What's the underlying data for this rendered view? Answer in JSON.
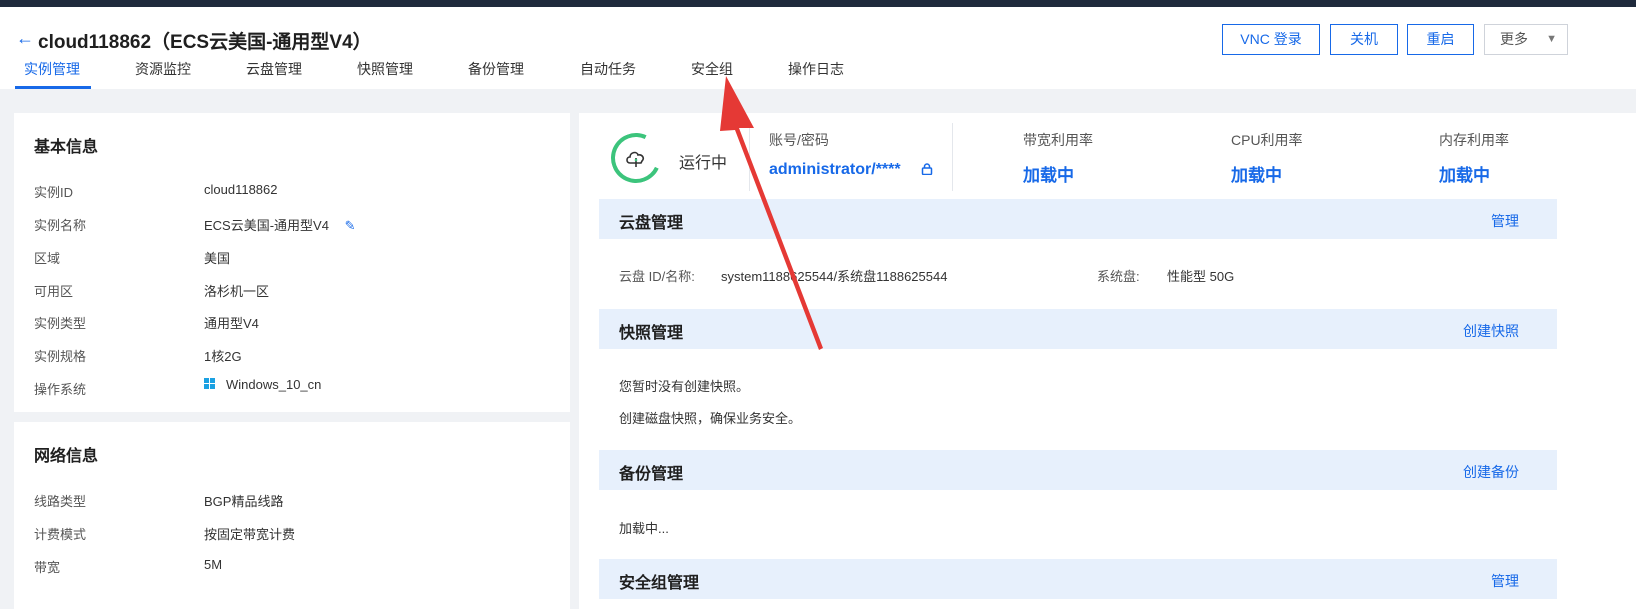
{
  "header": {
    "title": "cloud118862（ECS云美国-通用型V4）",
    "buttons": {
      "vnc": "VNC 登录",
      "shutdown": "关机",
      "restart": "重启",
      "more": "更多"
    }
  },
  "tabs": [
    "实例管理",
    "资源监控",
    "云盘管理",
    "快照管理",
    "备份管理",
    "自动任务",
    "安全组",
    "操作日志"
  ],
  "basic_info": {
    "title": "基本信息",
    "rows": [
      {
        "label": "实例ID",
        "value": "cloud118862"
      },
      {
        "label": "实例名称",
        "value": "ECS云美国-通用型V4"
      },
      {
        "label": "区域",
        "value": "美国"
      },
      {
        "label": "可用区",
        "value": "洛杉机一区"
      },
      {
        "label": "实例类型",
        "value": "通用型V4"
      },
      {
        "label": "实例规格",
        "value": "1核2G"
      },
      {
        "label": "操作系统",
        "value": "Windows_10_cn"
      }
    ]
  },
  "network_info": {
    "title": "网络信息",
    "rows": [
      {
        "label": "线路类型",
        "value": "BGP精品线路"
      },
      {
        "label": "计费模式",
        "value": "按固定带宽计费"
      },
      {
        "label": "带宽",
        "value": "5M"
      }
    ]
  },
  "status": {
    "state": "运行中",
    "account_label": "账号/密码",
    "account_value": "administrator/****",
    "bandwidth_label": "带宽利用率",
    "bandwidth_value": "加载中",
    "cpu_label": "CPU利用率",
    "cpu_value": "加载中",
    "mem_label": "内存利用率",
    "mem_value": "加载中"
  },
  "disk": {
    "title": "云盘管理",
    "link": "管理",
    "id_label": "云盘 ID/名称:",
    "id_value": "system1188625544/系统盘1188625544",
    "sys_label": "系统盘:",
    "sys_value": "性能型 50G"
  },
  "snapshot": {
    "title": "快照管理",
    "link": "创建快照",
    "line1": "您暂时没有创建快照。",
    "line2": "创建磁盘快照，确保业务安全。"
  },
  "backup": {
    "title": "备份管理",
    "link": "创建备份",
    "loading": "加载中..."
  },
  "security": {
    "title": "安全组管理",
    "link": "管理"
  },
  "colors": {
    "accent": "#1769e8",
    "running": "#3cc47c",
    "annotation_arrow": "#e53935"
  }
}
